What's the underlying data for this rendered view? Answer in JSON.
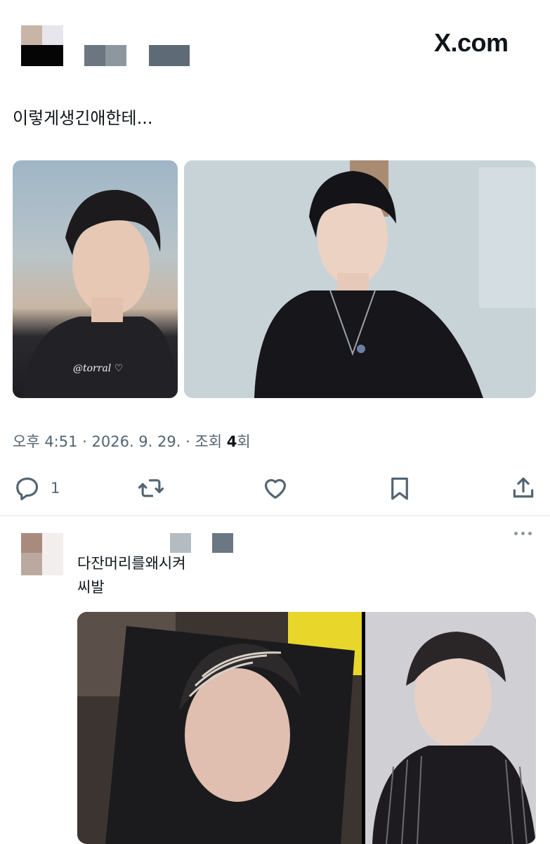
{
  "brand": {
    "logo_text": "X.com"
  },
  "post": {
    "text": "이렇게생긴애한테...",
    "meta": {
      "time_date": "오후 4:51 · 2026. 9. 29. · 조회 ",
      "views": "4",
      "views_suffix": "회"
    },
    "images": [
      {
        "alt": "portrait-left",
        "overlay_text": "@torral ♡"
      },
      {
        "alt": "portrait-right"
      }
    ],
    "actions": {
      "reply_icon": "reply-icon",
      "reply_count": "1",
      "repost_icon": "repost-icon",
      "like_icon": "heart-icon",
      "bookmark_icon": "bookmark-icon",
      "share_icon": "share-icon"
    }
  },
  "reply": {
    "line1": "다잔머리를왜시켜",
    "line2": "씨발",
    "images": [
      {
        "alt": "braided-photocard-left"
      },
      {
        "alt": "braided-photocard-right"
      }
    ]
  },
  "colors": {
    "text": "#0f1419",
    "secondary": "#536471",
    "divider": "#e1e6ea"
  }
}
